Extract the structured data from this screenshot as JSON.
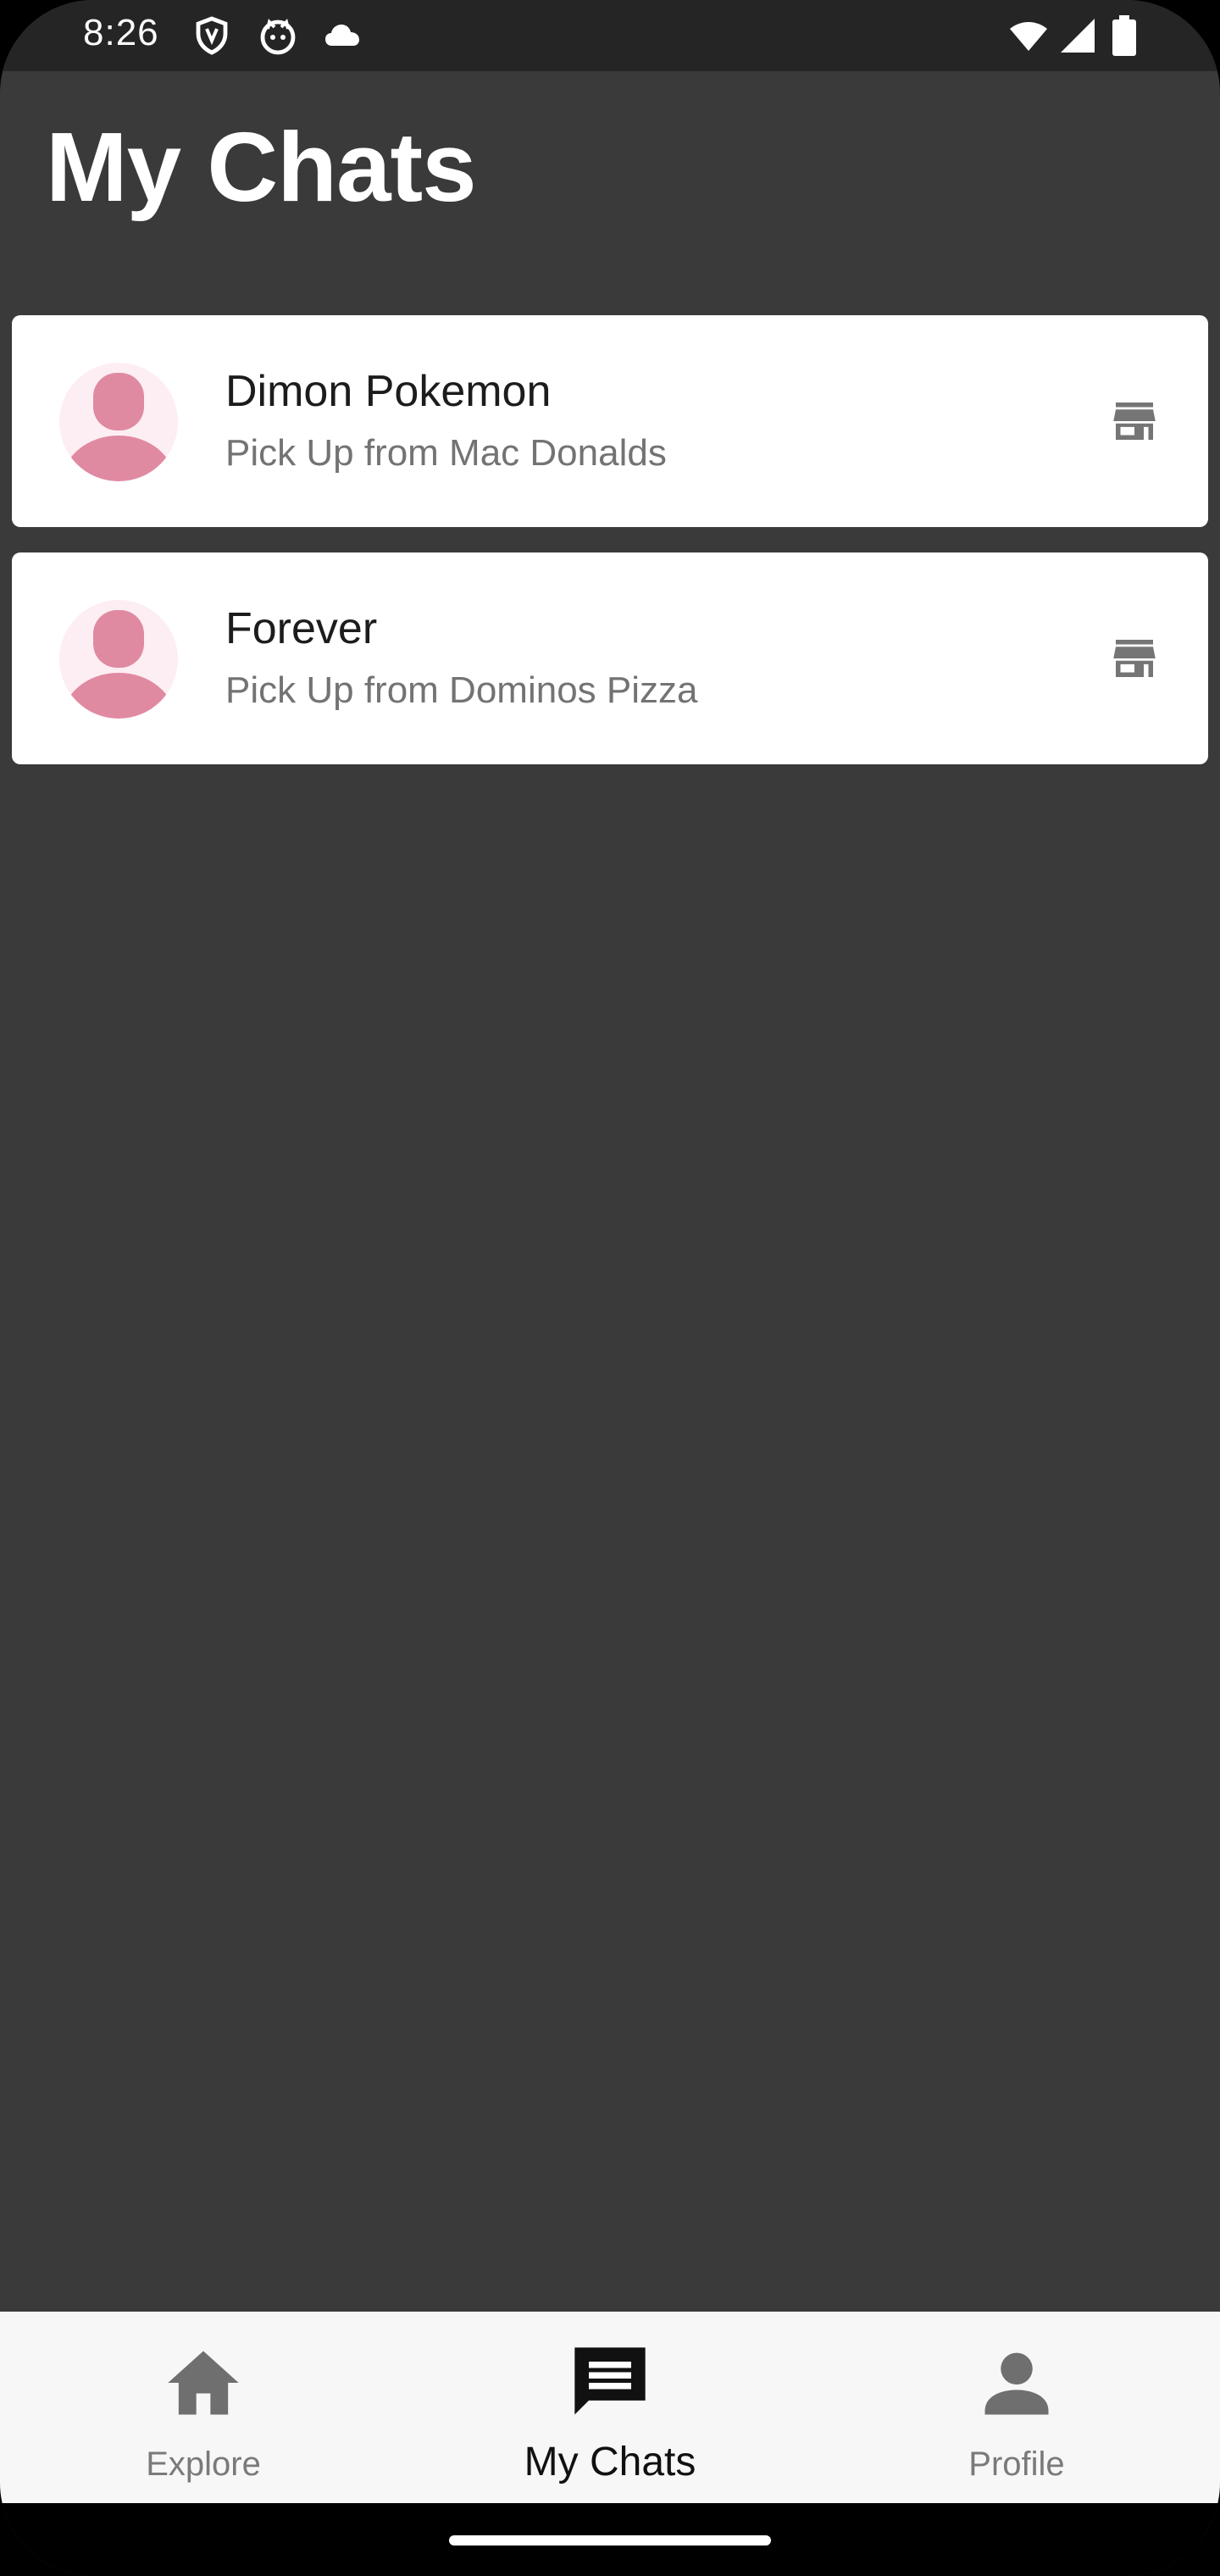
{
  "status_bar": {
    "time": "8:26",
    "icons": [
      "shield-icon",
      "cat-icon",
      "cloud-icon",
      "wifi-icon",
      "signal-icon",
      "battery-icon"
    ]
  },
  "header": {
    "title": "My Chats"
  },
  "chats": [
    {
      "name": "Dimon Pokemon",
      "subtitle": "Pick Up from Mac Donalds",
      "avatar_icon": "person-icon",
      "action_icon": "store-icon"
    },
    {
      "name": "Forever",
      "subtitle": "Pick Up from Dominos Pizza",
      "avatar_icon": "person-icon",
      "action_icon": "store-icon"
    }
  ],
  "bottom_nav": {
    "items": [
      {
        "label": "Explore",
        "icon": "home-icon",
        "active": false
      },
      {
        "label": "My Chats",
        "icon": "chat-icon",
        "active": true
      },
      {
        "label": "Profile",
        "icon": "person-icon",
        "active": false
      }
    ]
  },
  "colors": {
    "background": "#3a3a3a",
    "status_bar": "#252525",
    "card": "#ffffff",
    "avatar_accent": "#e08aa2",
    "avatar_bg": "#fdeef3",
    "nav_bg": "#f7f7f7",
    "inactive": "#7a7a7a"
  }
}
